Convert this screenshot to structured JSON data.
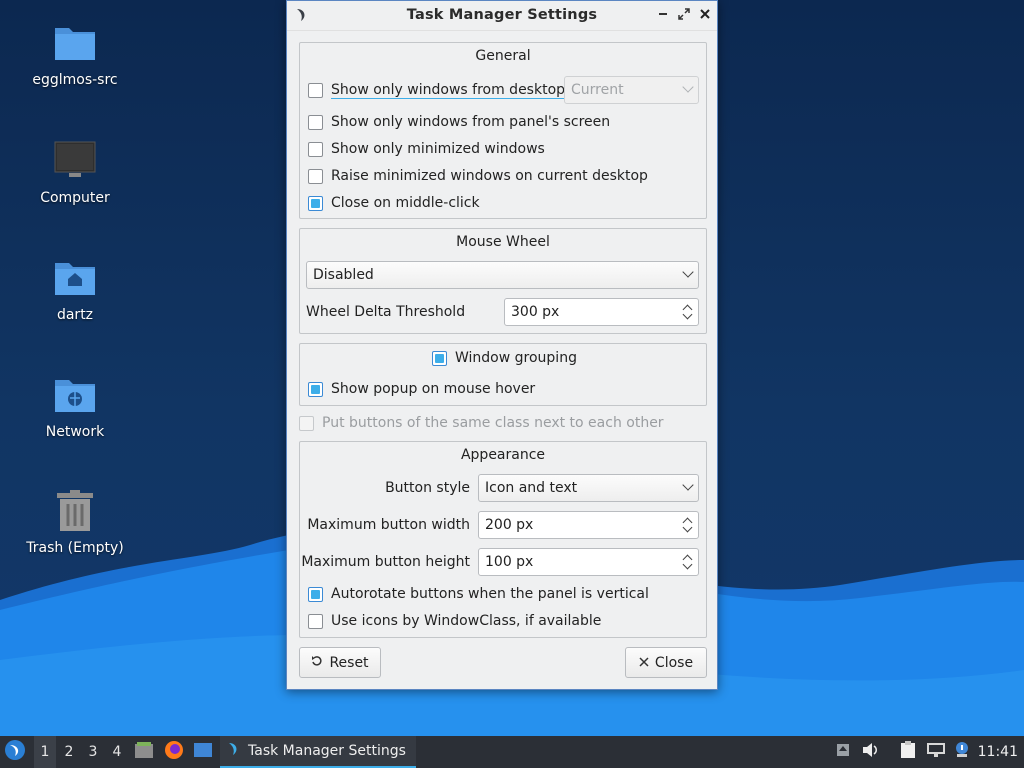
{
  "desktop": {
    "icons": [
      {
        "label": "egglmos-src",
        "icon": "folder-icon"
      },
      {
        "label": "Computer",
        "icon": "computer-icon"
      },
      {
        "label": "dartz",
        "icon": "home-folder-icon"
      },
      {
        "label": "Network",
        "icon": "network-folder-icon"
      },
      {
        "label": "Trash (Empty)",
        "icon": "trash-icon"
      }
    ]
  },
  "window": {
    "title": "Task Manager Settings",
    "controls": {
      "minimize": "▬",
      "maximize": "⤢",
      "close": "✕"
    },
    "general": {
      "title": "General",
      "show_desktop": {
        "label": "Show only windows from desktop",
        "checked": false
      },
      "desktop_combo": {
        "value": "Current",
        "enabled": false
      },
      "show_screen": {
        "label": "Show only windows from panel's screen",
        "checked": false
      },
      "show_minimized": {
        "label": "Show only minimized windows",
        "checked": false
      },
      "raise_minimized": {
        "label": "Raise minimized windows on current desktop",
        "checked": false
      },
      "close_middle": {
        "label": "Close on middle-click",
        "checked": true
      }
    },
    "mouse_wheel": {
      "title": "Mouse Wheel",
      "mode": "Disabled",
      "threshold_label": "Wheel Delta Threshold",
      "threshold_value": "300 px"
    },
    "grouping": {
      "window_grouping": {
        "label": "Window grouping",
        "checked": true
      },
      "popup_hover": {
        "label": "Show popup on mouse hover",
        "checked": true
      }
    },
    "same_class": {
      "label": "Put buttons of the same class next to each other",
      "checked": false,
      "enabled": false
    },
    "appearance": {
      "title": "Appearance",
      "button_style_label": "Button style",
      "button_style_value": "Icon and text",
      "max_width_label": "Maximum button width",
      "max_width_value": "200 px",
      "max_height_label": "Maximum button height",
      "max_height_value": "100 px",
      "autorotate": {
        "label": "Autorotate buttons when the panel is vertical",
        "checked": true
      },
      "use_icons": {
        "label": "Use icons by WindowClass, if available",
        "checked": false
      }
    },
    "buttons": {
      "reset": "Reset",
      "close": "Close"
    }
  },
  "taskbar": {
    "workspaces": [
      "1",
      "2",
      "3",
      "4"
    ],
    "active_workspace": "1",
    "task_title": "Task Manager Settings",
    "clock": "11:41"
  },
  "colors": {
    "accent": "#3daee9",
    "taskbar": "#2b2f36",
    "window_bg": "#eff0f1"
  }
}
